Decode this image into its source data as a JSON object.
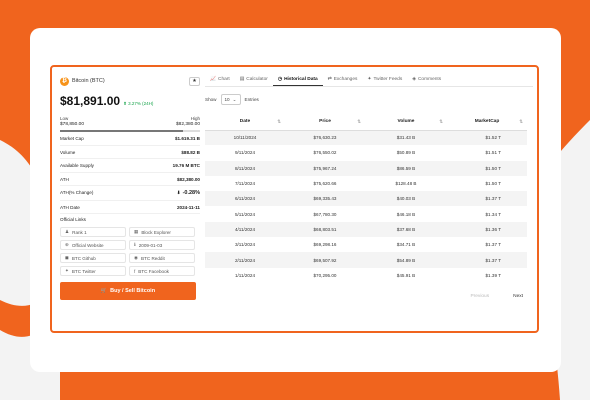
{
  "coin": {
    "logo_glyph": "₿",
    "name": "Bitcoin (BTC)",
    "star_glyph": "★",
    "price": "$81,891.00",
    "change": "3.27% (24H)",
    "change_glyph": "⬆",
    "low_label": "Low",
    "high_label": "High",
    "low_value": "$78,850.00",
    "high_value": "$82,380.00",
    "range_position": 0.88
  },
  "stats": [
    {
      "label": "Market Cap",
      "value": "$1.619.31 B"
    },
    {
      "label": "Volume",
      "value": "$88.82 B"
    },
    {
      "label": "Available Supply",
      "value": "19.76 M BTC"
    },
    {
      "label": "ATH",
      "value": "$82,380.00"
    },
    {
      "label": "ATH(% Change)",
      "value": "-0.28%",
      "arrow": "⬇"
    },
    {
      "label": "ATH Date",
      "value": "2024-11-11"
    }
  ],
  "links_title": "Official Links",
  "links": [
    {
      "icon": "♟",
      "label": "Rank 1"
    },
    {
      "icon": "▦",
      "label": "Block Explorer"
    },
    {
      "icon": "⊕",
      "label": "Official Website"
    },
    {
      "icon": "ℹ",
      "label": "2009-01-03"
    },
    {
      "icon": "◼",
      "label": "BTC Github"
    },
    {
      "icon": "◉",
      "label": "BTC Reddit"
    },
    {
      "icon": "✦",
      "label": "BTC Twitter"
    },
    {
      "icon": "f",
      "label": "BTC Facebook"
    }
  ],
  "buy_button": {
    "icon": "🛒",
    "label": "Buy / Sell Bitcoin"
  },
  "tabs": [
    {
      "icon": "📈",
      "label": "Chart"
    },
    {
      "icon": "▤",
      "label": "Calculator"
    },
    {
      "icon": "◷",
      "label": "Historical Data"
    },
    {
      "icon": "⇄",
      "label": "Exchanges"
    },
    {
      "icon": "✦",
      "label": "Twitter Feeds"
    },
    {
      "icon": "◈",
      "label": "Comments"
    }
  ],
  "show": {
    "label": "Show",
    "value": "10",
    "suffix": "Entries"
  },
  "table": {
    "headers": [
      "Date",
      "Price",
      "Volume",
      "MarketCap"
    ],
    "rows": [
      [
        "10/11/2024",
        "$76,630.23",
        "$31.43 B",
        "$1.52 T"
      ],
      [
        "9/11/2024",
        "$76,550.02",
        "$50.89 B",
        "$1.51 T"
      ],
      [
        "8/11/2024",
        "$75,967.24",
        "$86.59 B",
        "$1.50 T"
      ],
      [
        "7/11/2024",
        "$75,620.66",
        "$128.48 B",
        "$1.50 T"
      ],
      [
        "6/11/2024",
        "$69,335.43",
        "$40.03 B",
        "$1.37 T"
      ],
      [
        "5/11/2024",
        "$67,780.30",
        "$46.18 B",
        "$1.34 T"
      ],
      [
        "4/11/2024",
        "$68,803.51",
        "$37.68 B",
        "$1.36 T"
      ],
      [
        "3/11/2024",
        "$69,298.16",
        "$34.71 B",
        "$1.37 T"
      ],
      [
        "2/11/2024",
        "$69,507.92",
        "$54.89 B",
        "$1.37 T"
      ],
      [
        "1/11/2024",
        "$70,295.00",
        "$45.91 B",
        "$1.39 T"
      ]
    ]
  },
  "pager": {
    "previous": "Previous",
    "next": "Next"
  },
  "colors": {
    "accent": "#f0641e",
    "positive": "#16a34a"
  }
}
